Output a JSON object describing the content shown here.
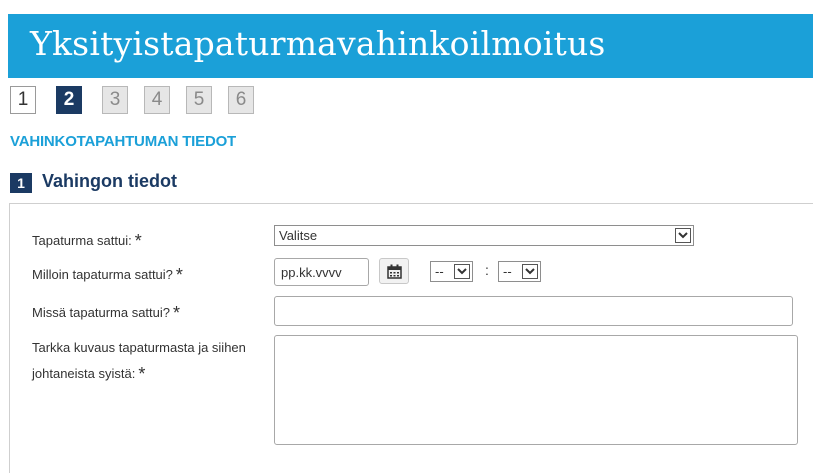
{
  "header": {
    "title": "Yksityistapaturmavahinkoilmoitus",
    "bg_color": "#1ba0d8"
  },
  "steps": [
    {
      "label": "1",
      "state": "done"
    },
    {
      "label": "2",
      "state": "active"
    },
    {
      "label": "3",
      "state": "disabled"
    },
    {
      "label": "4",
      "state": "disabled"
    },
    {
      "label": "5",
      "state": "disabled"
    },
    {
      "label": "6",
      "state": "disabled"
    }
  ],
  "section": {
    "heading": "VAHINKOTAPAHTUMAN TIEDOT"
  },
  "subsection": {
    "number": "1",
    "title": "Vahingon tiedot"
  },
  "form": {
    "required_mark": "*",
    "accident_type": {
      "label": "Tapaturma sattui:",
      "selected": "Valitse"
    },
    "accident_time": {
      "label": "Milloin tapaturma sattui?",
      "date_placeholder": "pp.kk.vvvv",
      "hour_selected": "--",
      "minute_selected": "--",
      "time_separator": ":"
    },
    "accident_place": {
      "label": "Missä tapaturma sattui?"
    },
    "description": {
      "label": "Tarkka kuvaus tapaturmasta ja siihen johtaneista syistä:"
    }
  },
  "colors": {
    "accent": "#1ba0d8",
    "navy": "#1b3a63"
  },
  "icons": {
    "calendar": "calendar-icon",
    "dropdown": "chevron-down-icon"
  }
}
